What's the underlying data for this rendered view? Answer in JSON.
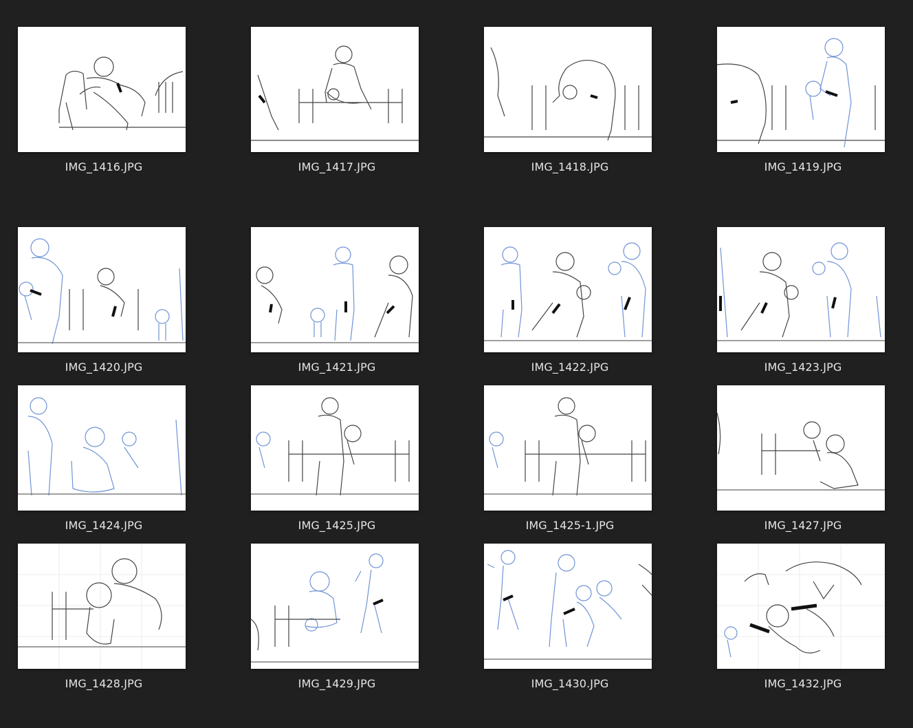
{
  "gallery": {
    "items": [
      {
        "filename": "IMG_1416.JPG",
        "sketch": "pencil"
      },
      {
        "filename": "IMG_1417.JPG",
        "sketch": "pencil"
      },
      {
        "filename": "IMG_1418.JPG",
        "sketch": "pencil"
      },
      {
        "filename": "IMG_1419.JPG",
        "sketch": "mixed"
      },
      {
        "filename": "IMG_1420.JPG",
        "sketch": "mixed"
      },
      {
        "filename": "IMG_1421.JPG",
        "sketch": "mixed"
      },
      {
        "filename": "IMG_1422.JPG",
        "sketch": "mixed"
      },
      {
        "filename": "IMG_1423.JPG",
        "sketch": "mixed"
      },
      {
        "filename": "IMG_1424.JPG",
        "sketch": "blue"
      },
      {
        "filename": "IMG_1425.JPG",
        "sketch": "pencil"
      },
      {
        "filename": "IMG_1425-1.JPG",
        "sketch": "pencil"
      },
      {
        "filename": "IMG_1427.JPG",
        "sketch": "pencil"
      },
      {
        "filename": "IMG_1428.JPG",
        "sketch": "pencil"
      },
      {
        "filename": "IMG_1429.JPG",
        "sketch": "blue"
      },
      {
        "filename": "IMG_1430.JPG",
        "sketch": "blue"
      },
      {
        "filename": "IMG_1432.JPG",
        "sketch": "pencil"
      }
    ]
  },
  "colors": {
    "background": "#202020",
    "label": "#e6e6e6",
    "pencil": "#3a3a3a",
    "blue_pencil": "#6f93d6",
    "thumbnail_bg": "#ffffff"
  }
}
